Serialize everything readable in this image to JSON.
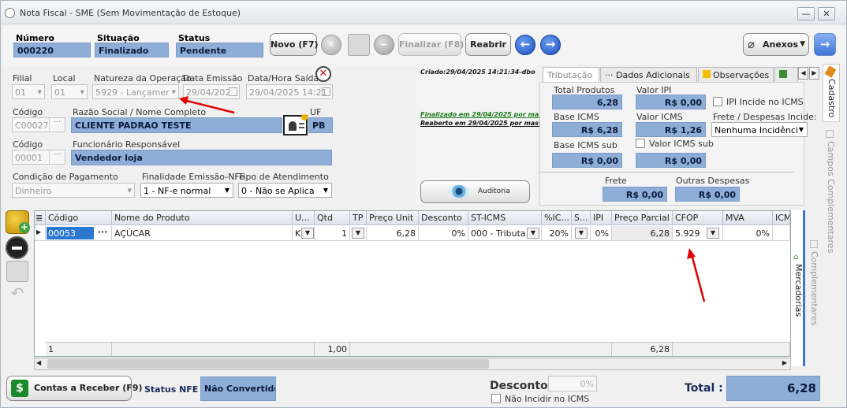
{
  "window": {
    "title": "Nota Fiscal - SME (Sem Movimentação de Estoque)"
  },
  "header": {
    "numero_label": "Número",
    "numero": "000220",
    "situacao_label": "Situação",
    "situacao": "Finalizado",
    "status_label": "Status",
    "status": "Pendente"
  },
  "toolbar": {
    "novo": "Novo (F7)",
    "finalizar": "Finalizar (F8)",
    "reabrir": "Reabrir",
    "anexos": "Anexos"
  },
  "form": {
    "filial_label": "Filial",
    "filial": "01",
    "local_label": "Local",
    "local": "01",
    "natureza_label": "Natureza da Operação",
    "natureza": "5929 - Lançamer",
    "data_emissao_label": "Data Emissão",
    "data_emissao": "29/04/202",
    "data_hora_saida_label": "Data/Hora Saída",
    "data_hora_saida": "29/04/2025 14:21",
    "codigo_label": "Código",
    "codigo": "C00027",
    "razao_label": "Razão Social / Nome Completo",
    "razao": "CLIENTE PADRAO TESTE",
    "uf_label": "UF",
    "uf": "PB",
    "codigo2_label": "Código",
    "codigo2": "00001",
    "funcionario_label": "Funcionário Responsável",
    "funcionario": "Vendedor loja",
    "condicao_label": "Condição de Pagamento",
    "condicao": "Dinheiro",
    "finalidade_label": "Finalidade Emissão-NFe",
    "finalidade": "1 - NF-e normal",
    "tipo_atend_label": "Tipo de Atendimento",
    "tipo_atend": "0 - Não se Aplica"
  },
  "notes": {
    "criado": "Criado:29/04/2025 14:21:34-dbo",
    "finalizado": "Finalizado em 29/04/2025 por mas",
    "reaberto": "Reaberto em 29/04/2025 por mast",
    "auditoria": "Auditoria"
  },
  "tabs": {
    "tributacao": "Tributação",
    "dados": "Dados Adicionais",
    "obs": "Observações"
  },
  "trib": {
    "total_produtos_label": "Total Produtos",
    "total_produtos": "6,28",
    "valor_ipi_label": "Valor IPI",
    "valor_ipi": "R$ 0,00",
    "ipi_incide_label": "IPI Incide no ICMS",
    "base_icms_label": "Base ICMS",
    "base_icms": "R$ 6,28",
    "valor_icms_label": "Valor ICMS",
    "valor_icms": "R$ 1,26",
    "frete_desp_label": "Frete / Despesas Incide:",
    "frete_desp": "Nenhuma Incidênci",
    "base_icms_sub_label": "Base ICMS sub",
    "base_icms_sub": "R$ 0,00",
    "valor_icms_sub_label": "Valor ICMS sub",
    "valor_icms_sub": "R$ 0,00",
    "frete_label": "Frete",
    "frete": "R$ 0,00",
    "outras_label": "Outras Despesas",
    "outras": "R$ 0,00"
  },
  "grid": {
    "headers": [
      "Código",
      "Nome do Produto",
      "U...",
      "Qtd",
      "TP",
      "Preço Unit",
      "Desconto",
      "ST-ICMS",
      "%IC...",
      "S...",
      "IPI",
      "Preço Parcial",
      "CFOP",
      "MVA",
      "ICM"
    ],
    "row": {
      "codigo": "00053",
      "nome": "AÇÚCAR",
      "un": "K",
      "qtd": "1",
      "preco": "6,28",
      "desc": "0%",
      "st": "000 - Tributa...",
      "ic": "20%",
      "ipi": "0%",
      "parcial": "6,28",
      "cfop": "5.929",
      "mva": "0%"
    },
    "footer": {
      "count": "1",
      "qtd": "1,00",
      "parcial": "6,28"
    }
  },
  "side": {
    "cadastro": "Cadastro",
    "campos": "Campos Complementares",
    "mercadorias": "Mercadorias",
    "complementares": "Complementares"
  },
  "bottom": {
    "contas": "Contas a Receber (F9)",
    "status_nfe_label": "Status NFE :",
    "status_nfe": "Não Convertido",
    "desconto_label": "Desconto:",
    "desconto": "0%",
    "nao_incidir": "Não Incidir no ICMS",
    "total_label": "Total :",
    "total": "6,28"
  }
}
